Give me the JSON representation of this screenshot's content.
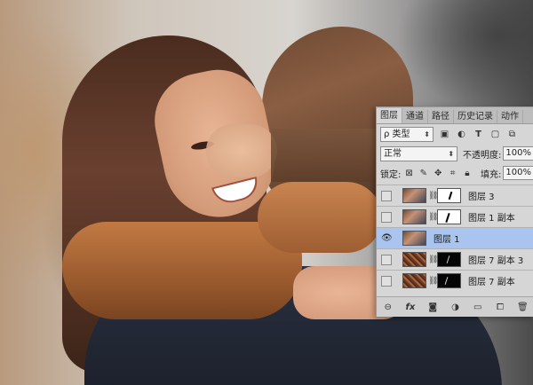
{
  "panel": {
    "tabs": [
      "图层",
      "通道",
      "路径",
      "历史记录",
      "动作"
    ],
    "filter": {
      "label": "ρ 类型",
      "icons": [
        "image-filter-icon",
        "adjustment-filter-icon",
        "type-filter-icon",
        "shape-filter-icon",
        "smart-filter-icon"
      ]
    },
    "blend_mode": "正常",
    "opacity_label": "不透明度:",
    "opacity_value": "100%",
    "lock_label": "锁定:",
    "fill_label": "填充:",
    "fill_value": "100%",
    "layers": [
      {
        "name": "图层 3",
        "visible": false,
        "thumb": "photo",
        "mask": "white",
        "selected": false
      },
      {
        "name": "图层 1 副本",
        "visible": false,
        "thumb": "photo",
        "mask": "white",
        "selected": false
      },
      {
        "name": "图层 1",
        "visible": true,
        "thumb": "photo",
        "mask": null,
        "selected": true
      },
      {
        "name": "图层 7 副本 3",
        "visible": false,
        "thumb": "texture",
        "mask": "black",
        "selected": false
      },
      {
        "name": "图层 7 副本",
        "visible": false,
        "thumb": "texture",
        "mask": "black",
        "selected": false
      }
    ],
    "bottom_icons": [
      "link-icon",
      "fx",
      "mask-icon",
      "adjustment-icon",
      "folder-icon",
      "new-layer-icon",
      "trash-icon"
    ]
  }
}
